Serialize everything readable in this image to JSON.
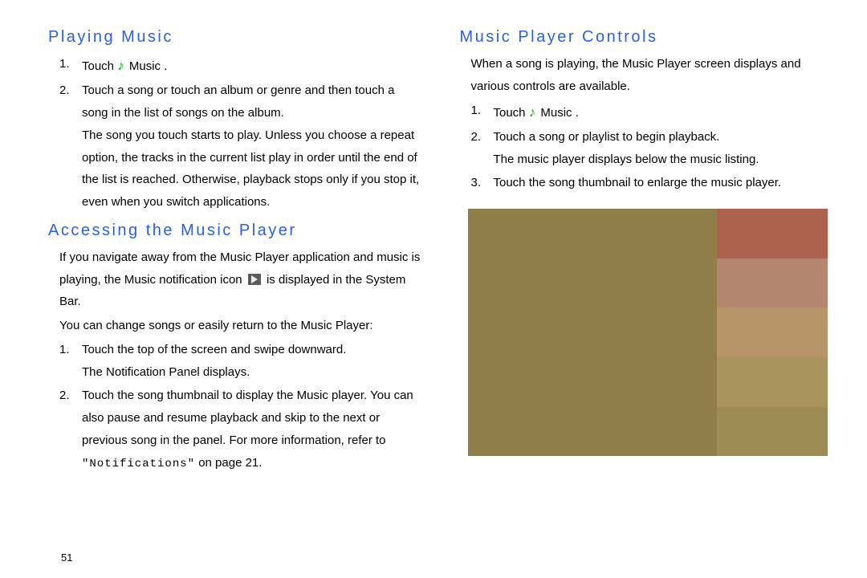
{
  "left": {
    "h1": "Playing Music",
    "s1_pre": "Touch",
    "s1_post": " Music .",
    "s2_a": "Touch a song or touch an album or genre and then touch a song in the list of songs on the album.",
    "s2_b": "The song you touch starts to play. Unless you choose a repeat option, the tracks in the current list play in order until the end of the list is reached. Otherwise, playback stops only if you stop it, even when you switch applications.",
    "h2": "Accessing the Music Player",
    "p1a": "If you navigate away from the Music Player application and music is playing, the Music notification icon ",
    "p1b": " is displayed in the System Bar.",
    "p2": "You can change songs or easily return to the Music Player:",
    "a1_a": "Touch the top of the screen and swipe downward.",
    "a1_b": "The Notification Panel displays.",
    "a2_a": "Touch the song thumbnail to display the Music player. You can also pause and resume playback and skip to the next or previous song in the panel. For more information, refer to ",
    "a2_ref": "\"Notifications\"",
    "a2_b": " on page 21."
  },
  "right": {
    "h1": "Music Player Controls",
    "p1": "When a song is playing, the Music Player screen displays and various controls are available.",
    "s1_pre": "Touch",
    "s1_post": " Music .",
    "s2_a": "Touch a song or playlist to begin playback.",
    "s2_b": "The music player displays below the music listing.",
    "s3": "Touch the song thumbnail to enlarge the music player."
  },
  "page_number": "51"
}
